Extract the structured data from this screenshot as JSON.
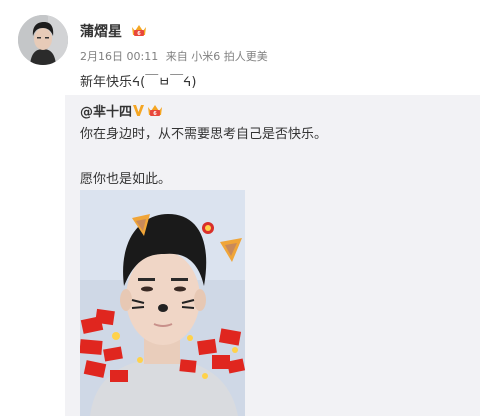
{
  "post": {
    "author": "蒲熠星",
    "time": "2月16日 00:11",
    "source_prefix": "来自",
    "source": "小米6 拍人更美",
    "content": "新年快乐ᔦ(￣ㅂ￣ᔦ)"
  },
  "repost": {
    "author": "@芈十四",
    "line1": "你在身边时，从不需要思考自己是否快乐。",
    "line2": "愿你也是如此。"
  },
  "colors": {
    "author_text": "#333333",
    "meta_text": "#808080",
    "repost_bg": "#f2f2f5",
    "verified_gold": "#f5a623",
    "badge_red": "#e8473c"
  },
  "icons": {
    "author_badge": "membership-crown-icon",
    "verified": "verified-v-icon",
    "repost_badge": "membership-crown-icon"
  }
}
